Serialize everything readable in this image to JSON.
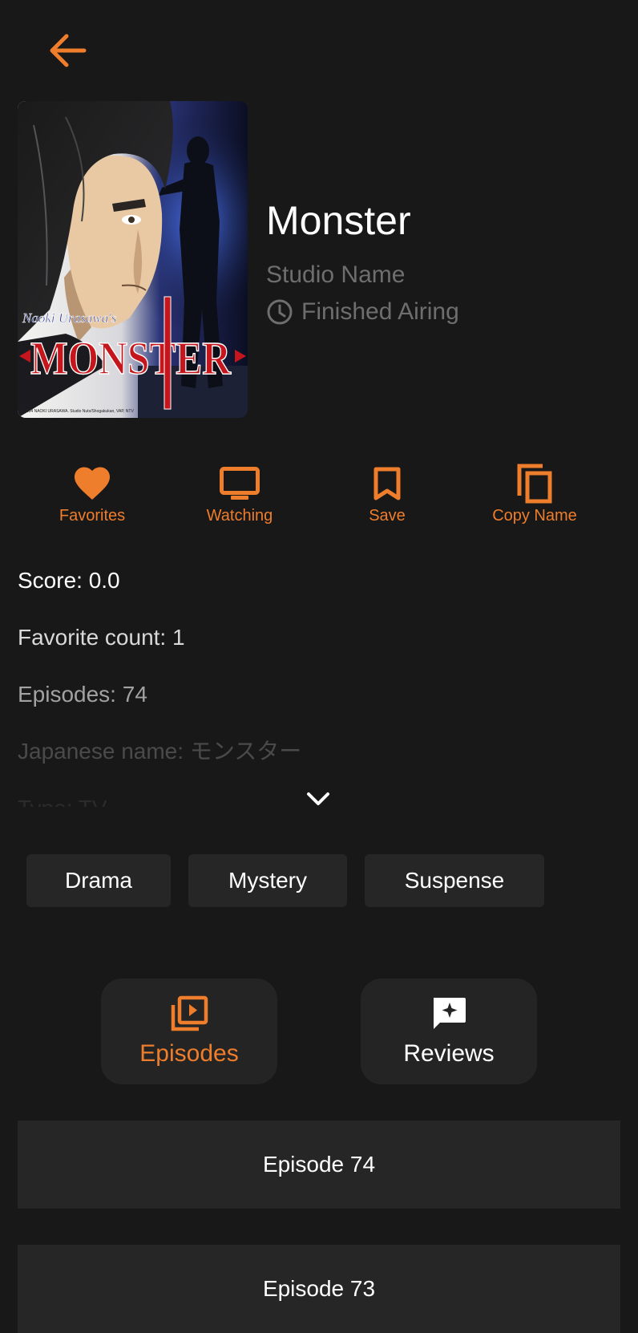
{
  "colors": {
    "background": "#181818",
    "accent": "#ee7d2c",
    "muted": "#6e6e6e",
    "card": "#262626"
  },
  "header": {
    "back_icon": "arrow-left-icon"
  },
  "anime": {
    "title": "Monster",
    "studio": "Studio Name",
    "status": "Finished Airing",
    "cover": {
      "series_tag": "Naoki Urasawa's",
      "logo_text": "MONSTER",
      "copyright": "© 2004 NAOKI URASAWA. Studio Nuts/Shogakukan, VAP, NTV"
    }
  },
  "actions": [
    {
      "label": "Favorites",
      "icon": "heart-icon"
    },
    {
      "label": "Watching",
      "icon": "tv-icon"
    },
    {
      "label": "Save",
      "icon": "bookmark-icon"
    },
    {
      "label": "Copy Name",
      "icon": "copy-icon"
    }
  ],
  "info": {
    "score": "Score: 0.0",
    "favorite_count": "Favorite count: 1",
    "episodes": "Episodes: 74",
    "japanese_name": "Japanese name: モンスター",
    "type": "Type: TV"
  },
  "genres": [
    "Drama",
    "Mystery",
    "Suspense"
  ],
  "tabs": [
    {
      "label": "Episodes",
      "icon": "video-library-icon"
    },
    {
      "label": "Reviews",
      "icon": "review-icon"
    }
  ],
  "episode_list": [
    "Episode 74",
    "Episode 73"
  ]
}
